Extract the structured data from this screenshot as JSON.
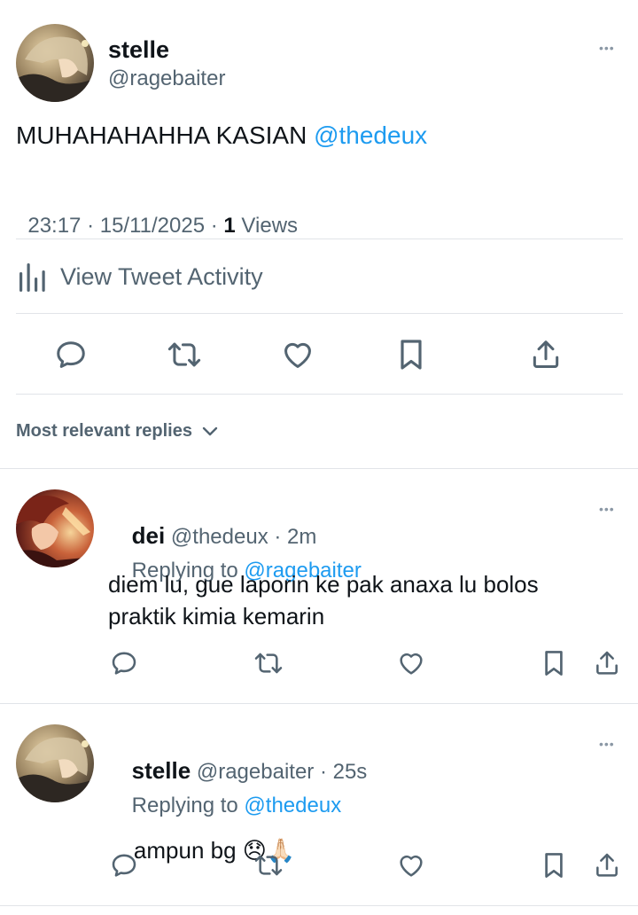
{
  "tweet": {
    "author_name": "stelle",
    "author_handle": "@ragebaiter",
    "text_prefix": "MUHAHAHAHHA KASIAN ",
    "text_mention": "@thedeux",
    "time": "23:17",
    "sep1": " · ",
    "date": "15/11/2025",
    "sep2": " · ",
    "views_count": "1",
    "views_label": " Views",
    "activity_label": "View Tweet Activity",
    "more_glyph": "•••"
  },
  "replies_sort": {
    "label": "Most relevant replies"
  },
  "replies": [
    {
      "name": "dei",
      "handle": "@thedeux",
      "meta": " · 2m",
      "replying_prefix": "Replying to ",
      "replying_to": "@ragebaiter",
      "text_line1": "diem lu, gue laporin ke pak anaxa lu bolos",
      "text_line2": "praktik kimia kemarin",
      "more_glyph": "•••"
    },
    {
      "name": "stelle",
      "handle": "@ragebaiter",
      "meta": " · 25s",
      "replying_prefix": "Replying to ",
      "replying_to": "@thedeux",
      "text": "ampun bg ",
      "emoji": "😞🙏🏻",
      "more_glyph": "•••"
    }
  ],
  "colors": {
    "accent": "#1d9bf0",
    "text_primary": "#0f1419",
    "text_secondary": "#536471",
    "divider": "#e1e4e8"
  },
  "icons": {
    "reply": "reply-icon",
    "retweet": "retweet-icon",
    "like": "heart-icon",
    "bookmark": "bookmark-icon",
    "share": "share-icon",
    "activity": "analytics-icon",
    "sort": "chevron-down-icon"
  }
}
